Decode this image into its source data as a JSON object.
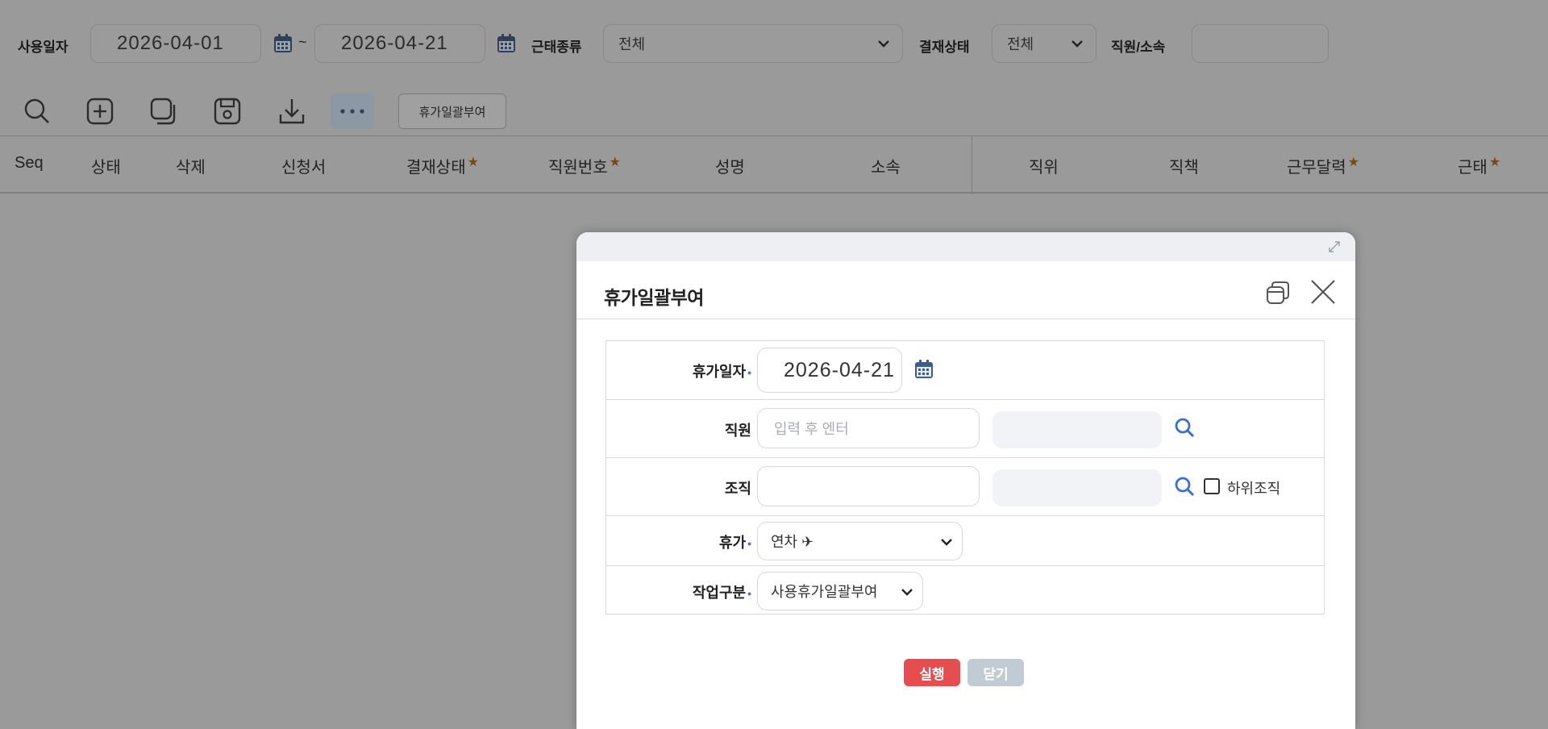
{
  "filters": {
    "use_date_label": "사용일자",
    "date_from": "2026-04-01",
    "tilde": "~",
    "date_to": "2026-04-21",
    "attendance_type_label": "근태종류",
    "attendance_type_value": "전체",
    "approval_status_label": "결재상태",
    "approval_status_value": "전체",
    "employee_org_label": "직원/소속",
    "employee_org_value": ""
  },
  "toolbar": {
    "icons": [
      "search-icon",
      "add-icon",
      "copy-icon",
      "save-icon",
      "download-icon",
      "more-icon"
    ],
    "bulk_grant_label": "휴가일괄부여"
  },
  "grid": {
    "columns": [
      {
        "label": "Seq",
        "required": false
      },
      {
        "label": "상태",
        "required": false
      },
      {
        "label": "삭제",
        "required": false
      },
      {
        "label": "신청서",
        "required": false
      },
      {
        "label": "결재상태",
        "required": true
      },
      {
        "label": "직원번호",
        "required": true
      },
      {
        "label": "성명",
        "required": false
      },
      {
        "label": "소속",
        "required": false
      },
      {
        "label": "직위",
        "required": false
      },
      {
        "label": "직책",
        "required": false
      },
      {
        "label": "근무달력",
        "required": true
      },
      {
        "label": "근태",
        "required": true
      }
    ],
    "required_mark": "★"
  },
  "dialog": {
    "title": "휴가일괄부여",
    "required_mark": "•",
    "fields": {
      "leave_date": {
        "label": "휴가일자",
        "value": "2026-04-21"
      },
      "employee": {
        "label": "직원",
        "placeholder": "입력 후 엔터",
        "value": ""
      },
      "organization": {
        "label": "조직",
        "value": "",
        "sub_org_label": "하위조직",
        "sub_org_checked": false
      },
      "leave": {
        "label": "휴가",
        "value": "연차 ✈"
      },
      "work_type": {
        "label": "작업구분",
        "value": "사용휴가일괄부여"
      }
    },
    "buttons": {
      "run": "실행",
      "close": "닫기"
    }
  },
  "colors": {
    "run_button": "#e54d4f",
    "close_button": "#c1cbd4",
    "accent_blue": "#3d6fd1",
    "overlay": "#9a9a9a"
  }
}
